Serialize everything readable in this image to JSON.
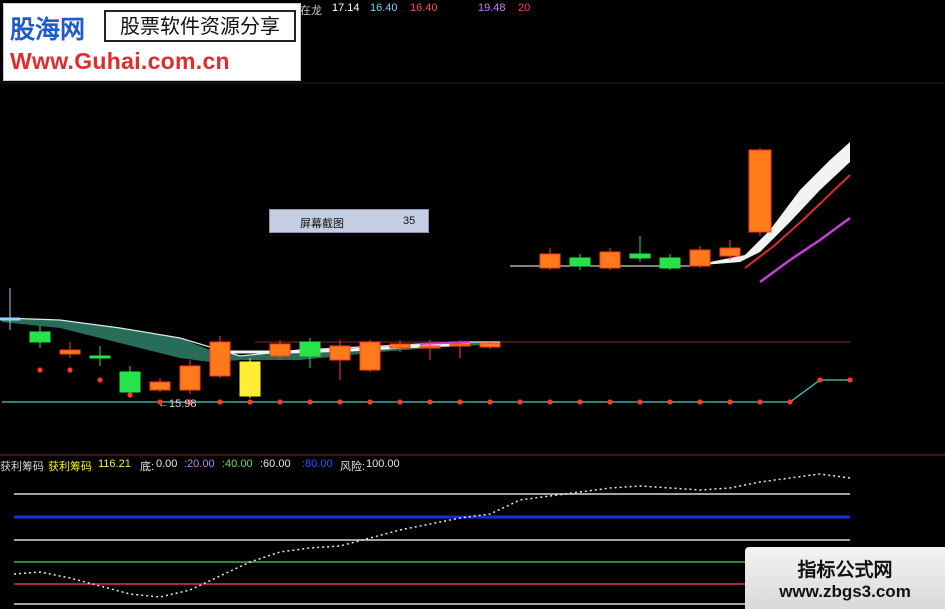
{
  "header_readout": {
    "partial_title": "在龙",
    "values": [
      "17.14",
      "16.40",
      "16.40",
      "19.48",
      "20"
    ],
    "colors": [
      "#ffffff",
      "#6fd3ff",
      "#ff4a4a",
      "#c77bff",
      "#ff4a4a"
    ]
  },
  "logo": {
    "brand": "股海网",
    "slogan": "股票软件资源分享",
    "url": "Www.Guhai.com.cn"
  },
  "tooltip": {
    "label": "屏幕截图",
    "value": "35"
  },
  "price_low_label": "←15.98",
  "indicator_header": {
    "name1": "获利筹码",
    "name2": "获利筹码",
    "value": "116.21",
    "bottom_label": "底:",
    "bottom_value": "0.00",
    "level_20": ":20.00",
    "level_40": ":40.00",
    "level_60": ":60.00",
    "level_80": ":80.00",
    "risk_label": "风险:",
    "risk_value": "100.00"
  },
  "watermark": {
    "title": "指标公式网",
    "url": "www.zbgs3.com"
  },
  "colors": {
    "up": "#ff3b1f",
    "up_fill": "#ff7a1a",
    "down": "#27e34a",
    "yellow": "#ffee33",
    "cyan_line": "#4ad0c4",
    "white_band": "#f2f2f2",
    "magenta": "#c63fd6",
    "blue_line": "#1d2bd6",
    "pink_line": "#e02a7a",
    "green_line": "#3fb34f",
    "background": "#000000"
  },
  "chart_data": {
    "type": "candlestick",
    "price_low_marker": 15.98,
    "indicator": {
      "name": "获利筹码",
      "value": 116.21,
      "levels": [
        0,
        20,
        40,
        60,
        80,
        100
      ]
    }
  }
}
